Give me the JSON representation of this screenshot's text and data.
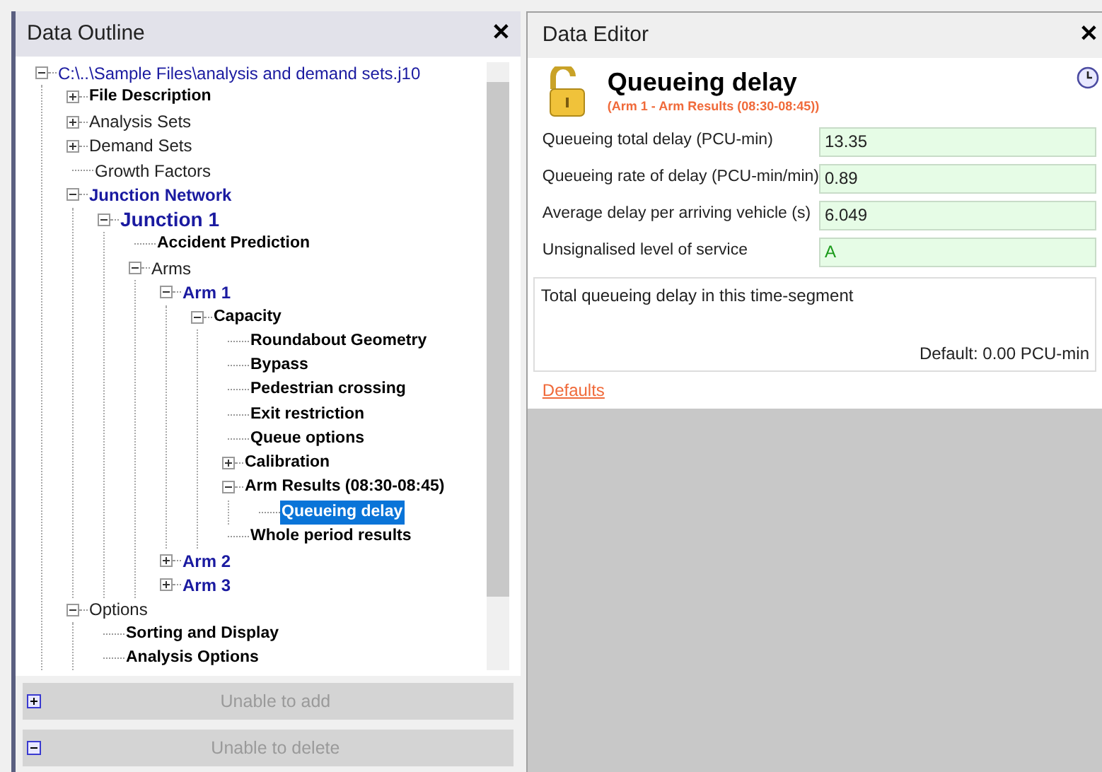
{
  "outline": {
    "title": "Data Outline",
    "close": "✕",
    "tree": [
      {
        "label": "C:\\..\\Sample Files\\analysis and demand sets.j10",
        "kind": "path",
        "expanded": true,
        "selected": false,
        "children": [
          {
            "label": "File Description",
            "kind": "bold",
            "expanded": false,
            "selected": false
          },
          {
            "label": "Analysis Sets",
            "kind": "plain",
            "expanded": false,
            "selected": false
          },
          {
            "label": "Demand Sets",
            "kind": "plain",
            "expanded": false,
            "selected": false
          },
          {
            "label": "Growth Factors",
            "kind": "plain",
            "selected": false
          },
          {
            "label": "Junction Network",
            "kind": "link",
            "expanded": true,
            "selected": false,
            "children": [
              {
                "label": "Junction 1",
                "kind": "link-large",
                "expanded": true,
                "selected": false,
                "children": [
                  {
                    "label": "Accident Prediction",
                    "kind": "bold",
                    "selected": false
                  },
                  {
                    "label": "Arms",
                    "kind": "plain",
                    "expanded": true,
                    "selected": false,
                    "children": [
                      {
                        "label": "Arm 1",
                        "kind": "link",
                        "expanded": true,
                        "selected": false,
                        "children": [
                          {
                            "label": "Capacity",
                            "kind": "bold",
                            "expanded": true,
                            "selected": false,
                            "children": [
                              {
                                "label": "Roundabout Geometry",
                                "kind": "bold",
                                "selected": false
                              },
                              {
                                "label": "Bypass",
                                "kind": "bold",
                                "selected": false
                              },
                              {
                                "label": "Pedestrian crossing",
                                "kind": "bold",
                                "selected": false
                              },
                              {
                                "label": "Exit restriction",
                                "kind": "bold",
                                "selected": false
                              },
                              {
                                "label": "Queue options",
                                "kind": "bold",
                                "selected": false
                              },
                              {
                                "label": "Calibration",
                                "kind": "bold",
                                "expanded": false,
                                "selected": false
                              },
                              {
                                "label": "Arm Results (08:30-08:45)",
                                "kind": "bold",
                                "expanded": true,
                                "selected": false,
                                "children": [
                                  {
                                    "label": "Queueing delay",
                                    "kind": "bold",
                                    "selected": true
                                  }
                                ]
                              },
                              {
                                "label": "Whole period results",
                                "kind": "bold",
                                "selected": false
                              }
                            ]
                          }
                        ]
                      },
                      {
                        "label": "Arm 2",
                        "kind": "link",
                        "expanded": false,
                        "selected": false
                      },
                      {
                        "label": "Arm 3",
                        "kind": "link",
                        "expanded": false,
                        "selected": false
                      }
                    ]
                  }
                ]
              }
            ]
          },
          {
            "label": "Options",
            "kind": "plain",
            "expanded": true,
            "selected": false,
            "children": [
              {
                "label": "Sorting and Display",
                "kind": "bold",
                "selected": false
              },
              {
                "label": "Analysis Options",
                "kind": "bold",
                "selected": false
              }
            ]
          }
        ]
      }
    ],
    "buttons": [
      {
        "kind": "add",
        "label": "Unable to add",
        "disabled": true
      },
      {
        "kind": "delete",
        "label": "Unable to delete",
        "disabled": true
      }
    ]
  },
  "editor": {
    "title": "Data Editor",
    "close": "✕",
    "heading": "Queueing delay",
    "subheading": "(Arm 1 - Arm Results (08:30-08:45))",
    "locked": false,
    "fields": [
      {
        "label": "Queueing total delay (PCU-min)",
        "value": "13.35"
      },
      {
        "label": "Queueing rate of delay (PCU-min/min)",
        "value": "0.89"
      },
      {
        "label": "Average delay per arriving vehicle (s)",
        "value": "6.049"
      },
      {
        "label": "Unsignalised level of service",
        "value": "A",
        "kind": "grade"
      }
    ],
    "description": "Total queueing delay in this time-segment",
    "default_text": "Default: 0.00 PCU-min",
    "defaults_link": "Defaults"
  }
}
